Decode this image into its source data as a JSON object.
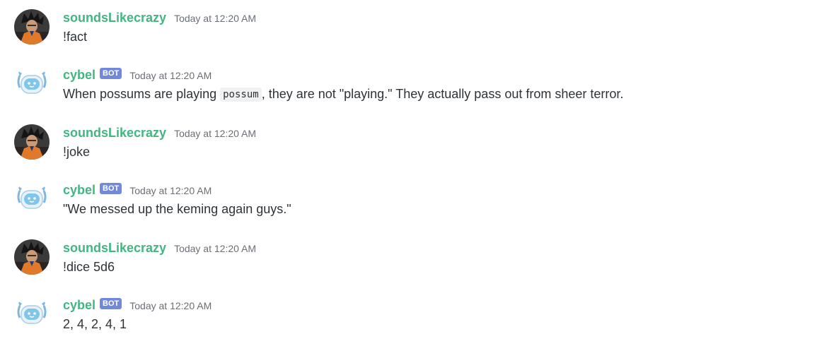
{
  "messages": [
    {
      "author": "soundsLikecrazy",
      "timestamp": "Today at 12:20 AM",
      "text": "!fact",
      "avatar_icon": "user-avatar-icon"
    },
    {
      "author": "cybel",
      "bot_tag": "BOT",
      "timestamp": "Today at 12:20 AM",
      "text_before": "When possums are playing ",
      "code": "possum",
      "text_after": ", they are not \"playing.\" They actually pass out from sheer terror.",
      "avatar_icon": "robot-avatar-icon"
    },
    {
      "author": "soundsLikecrazy",
      "timestamp": "Today at 12:20 AM",
      "text": "!joke",
      "avatar_icon": "user-avatar-icon"
    },
    {
      "author": "cybel",
      "bot_tag": "BOT",
      "timestamp": "Today at 12:20 AM",
      "text": "\"We messed up the keming again guys.\"",
      "avatar_icon": "robot-avatar-icon"
    },
    {
      "author": "soundsLikecrazy",
      "timestamp": "Today at 12:20 AM",
      "text": "!dice 5d6",
      "avatar_icon": "user-avatar-icon"
    },
    {
      "author": "cybel",
      "bot_tag": "BOT",
      "timestamp": "Today at 12:20 AM",
      "text": "2, 4, 2, 4, 1",
      "avatar_icon": "robot-avatar-icon"
    }
  ],
  "colors": {
    "username": "#43b581",
    "bot_tag": "#7289da",
    "timestamp": "#6a6f76",
    "text": "#2e3338"
  }
}
